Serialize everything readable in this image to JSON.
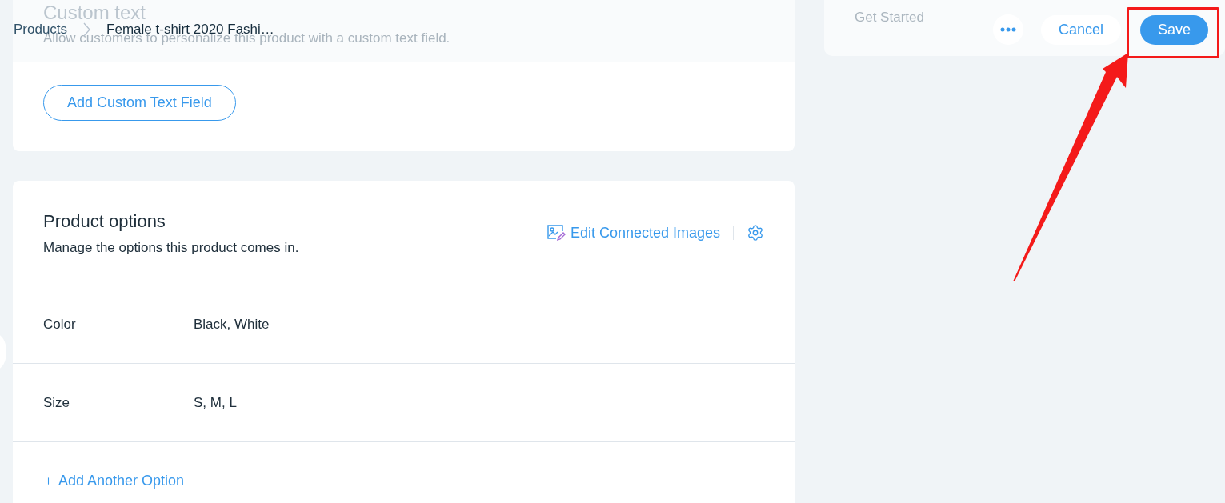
{
  "breadcrumb": [
    {
      "label": "Products"
    },
    {
      "label": "Female t-shirt 2020 Fashi…"
    }
  ],
  "header_actions": {
    "cancel": "Cancel",
    "save": "Save"
  },
  "get_started": {
    "label": "Get Started"
  },
  "custom_text": {
    "title": "Custom text",
    "description": "Allow customers to personalize this product with a custom text field.",
    "button": "Add Custom Text Field"
  },
  "product_options": {
    "title": "Product options",
    "description": "Manage the options this product comes in.",
    "edit_images": "Edit Connected Images",
    "options": [
      {
        "name": "Color",
        "values": "Black, White"
      },
      {
        "name": "Size",
        "values": "S, M, L"
      }
    ],
    "add_option": "Add Another Option"
  }
}
